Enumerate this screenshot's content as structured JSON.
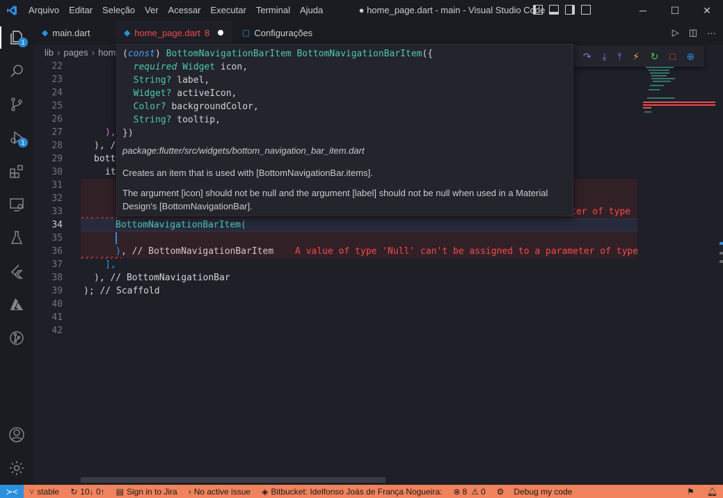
{
  "menu": [
    "Arquivo",
    "Editar",
    "Seleção",
    "Ver",
    "Acessar",
    "Executar",
    "Terminal",
    "Ajuda"
  ],
  "window_title": "● home_page.dart - main - Visual Studio Code",
  "tabs": [
    {
      "label": "main.dart",
      "color": "#cccccc"
    },
    {
      "label": "home_page.dart",
      "badge": "8",
      "color": "#f14c4c"
    },
    {
      "label": "Configurações",
      "color": "#cccccc"
    }
  ],
  "activity_badges": {
    "explorer": "1",
    "debug": "1"
  },
  "breadcrumb": [
    "lib",
    "pages",
    "hom"
  ],
  "line_numbers": [
    "22",
    "23",
    "24",
    "25",
    "26",
    "27",
    "28",
    "29",
    "30",
    "31",
    "32",
    "33",
    "34",
    "35",
    "36",
    "37",
    "38",
    "39",
    "40",
    "41",
    "42"
  ],
  "code": {
    "l27_close": "),",
    "l28": "), /",
    "l29": "bott",
    "l30": "it",
    "l33_error": "ter of type",
    "l34": "BottomNavigationBarItem(",
    "l36_close": ")",
    "l36_comment": ", // BottomNavigationBarItem",
    "l36_error": "A value of type 'Null' can't be assigned to a parameter of type",
    "l37": "],",
    "l38": "), // BottomNavigationBar",
    "l39": "); // Scaffold"
  },
  "hover": {
    "sig_open": "(const) BottomNavigationBarItem BottomNavigationBarItem({",
    "params": [
      {
        "mod": "required",
        "type": "Widget",
        "name": "icon,"
      },
      {
        "type": "String?",
        "name": "label,"
      },
      {
        "type": "Widget?",
        "name": "activeIcon,"
      },
      {
        "type": "Color?",
        "name": "backgroundColor,"
      },
      {
        "type": "String?",
        "name": "tooltip,"
      }
    ],
    "sig_close": "})",
    "package": "package:flutter/src/widgets/bottom_navigation_bar_item.dart",
    "desc1": "Creates an item that is used with [BottomNavigationBar.items].",
    "desc2": "The argument [icon] should not be null and the argument [label] should not be null when used in a Material Design's [BottomNavigationBar]."
  },
  "statusbar": {
    "branch": "stable",
    "sync": "10↓ 0↑",
    "jira": "Sign in to Jira",
    "issue": "No active issue",
    "bitbucket": "Bitbucket: Idelfonso Joás de França Nogueira:",
    "errors": "8",
    "warnings": "0",
    "debug": "Debug my code"
  },
  "colors": {
    "statusbar": "#f0835d",
    "accent": "#2b8fde",
    "error": "#f14c4c",
    "type": "#4ec9b0"
  }
}
